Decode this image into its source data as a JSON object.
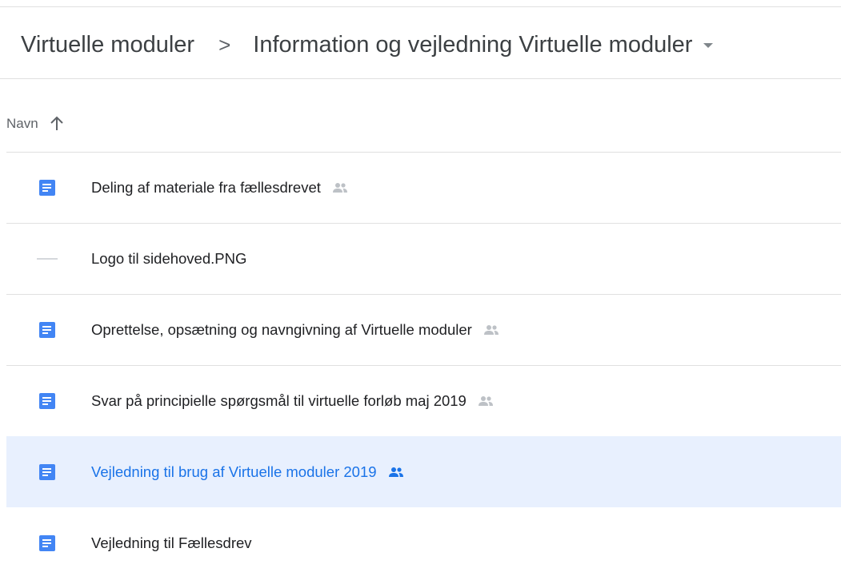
{
  "breadcrumb": {
    "parent": "Virtuelle moduler",
    "separator": ">",
    "current": "Information og vejledning Virtuelle moduler"
  },
  "column_header": {
    "name_label": "Navn",
    "sort": "ascending"
  },
  "colors": {
    "doc_icon": "#4285f4",
    "selected_bg": "#e8f0fe",
    "selected_text": "#1a73e8",
    "shared_icon": "#bdc1c6",
    "divider": "#e0e0e0"
  },
  "files": [
    {
      "name": "Deling af materiale fra fællesdrevet",
      "type": "doc",
      "icon": "docs-icon",
      "shared": true,
      "selected": false
    },
    {
      "name": "Logo til sidehoved.PNG",
      "type": "image",
      "icon": "image-thumbnail-icon",
      "shared": false,
      "selected": false
    },
    {
      "name": "Oprettelse, opsætning og navngivning af Virtuelle moduler",
      "type": "doc",
      "icon": "docs-icon",
      "shared": true,
      "selected": false
    },
    {
      "name": "Svar på principielle spørgsmål til virtuelle forløb maj 2019",
      "type": "doc",
      "icon": "docs-icon",
      "shared": true,
      "selected": false
    },
    {
      "name": "Vejledning til brug af Virtuelle moduler 2019",
      "type": "doc",
      "icon": "docs-icon",
      "shared": true,
      "selected": true
    },
    {
      "name": "Vejledning til Fællesdrev",
      "type": "doc",
      "icon": "docs-icon",
      "shared": false,
      "selected": false
    }
  ]
}
